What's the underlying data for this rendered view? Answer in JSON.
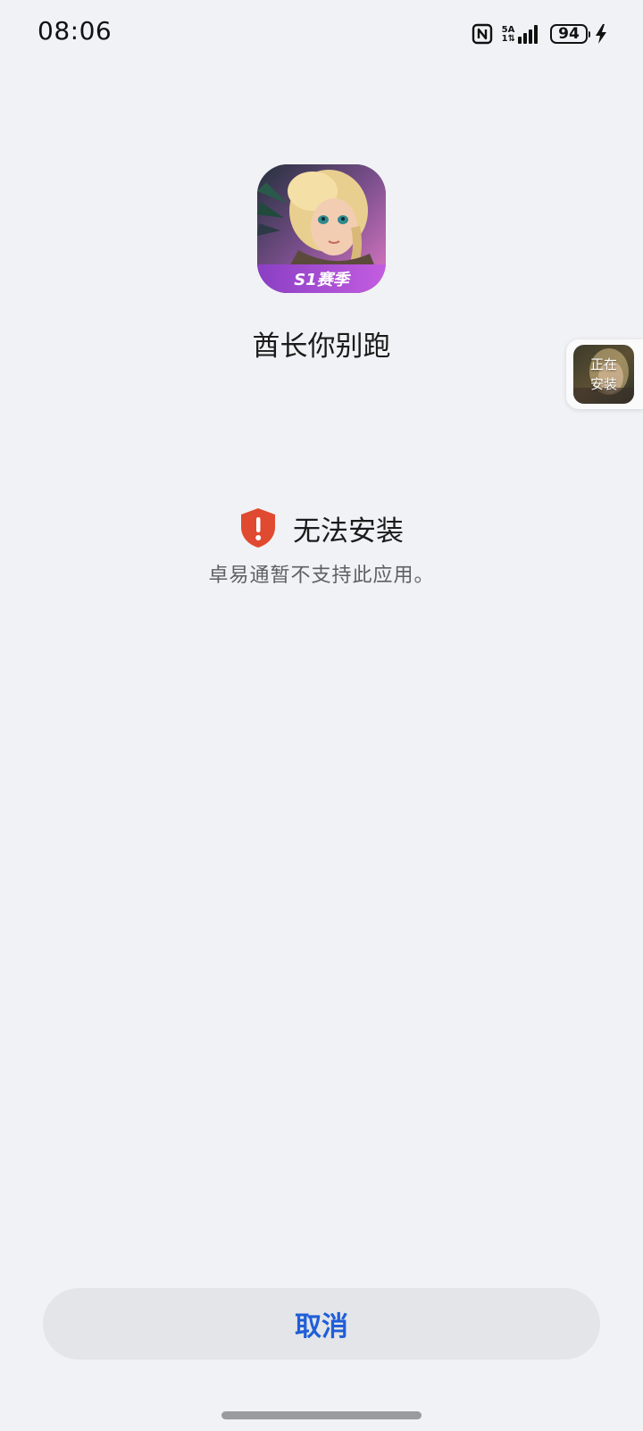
{
  "status_bar": {
    "time": "08:06",
    "network_top": "5A",
    "network_bottom": "1⇅",
    "battery_level": "94",
    "icons": [
      "nfc-icon",
      "signal-icon",
      "battery-icon",
      "charging-bolt-icon"
    ]
  },
  "app": {
    "name": "酋长你别跑",
    "icon_badge": "S1赛季"
  },
  "install_chip": {
    "line1": "正在",
    "line2": "安装"
  },
  "error": {
    "icon": "warning-shield-icon",
    "title": "无法安装",
    "description": "卓易通暂不支持此应用。"
  },
  "actions": {
    "cancel_label": "取消"
  },
  "colors": {
    "background": "#f1f2f5",
    "accent": "#1f5ed8",
    "error": "#e04a30",
    "button_bg": "#e4e5e8"
  }
}
